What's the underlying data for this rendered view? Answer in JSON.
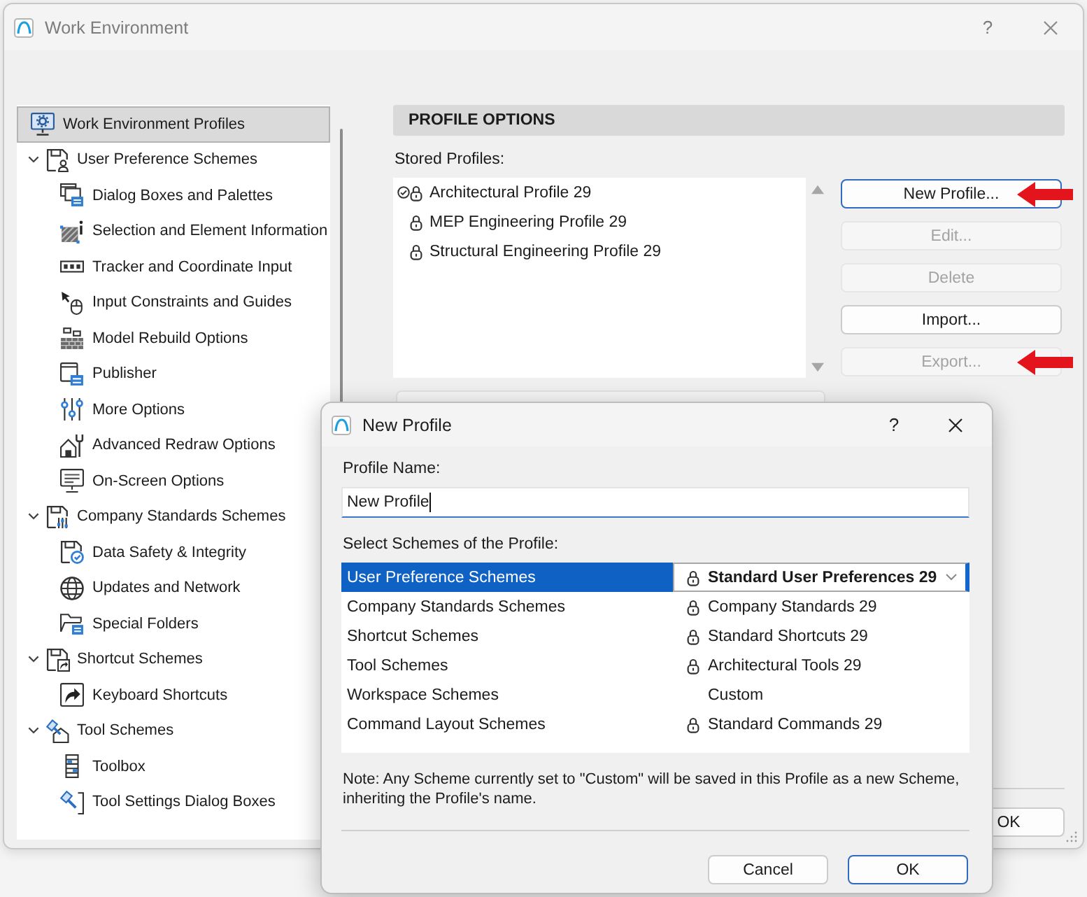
{
  "window": {
    "title": "Work Environment",
    "help": "?"
  },
  "sidebar": {
    "items": [
      {
        "label": "Work Environment Profiles",
        "selected": true
      },
      {
        "label": "User Preference Schemes",
        "selected": false,
        "expanded": true,
        "children": [
          {
            "label": "Dialog Boxes and Palettes",
            "selected": false
          },
          {
            "label": "Selection and Element Information",
            "selected": false
          },
          {
            "label": "Tracker and Coordinate Input",
            "selected": false
          },
          {
            "label": "Input Constraints and Guides",
            "selected": false
          },
          {
            "label": "Model Rebuild Options",
            "selected": false
          },
          {
            "label": "Publisher",
            "selected": false
          },
          {
            "label": "More Options",
            "selected": false
          },
          {
            "label": "Advanced Redraw Options",
            "selected": false
          },
          {
            "label": "On-Screen Options",
            "selected": false
          }
        ]
      },
      {
        "label": "Company Standards Schemes",
        "selected": false,
        "expanded": true,
        "children": [
          {
            "label": "Data Safety & Integrity",
            "selected": false
          },
          {
            "label": "Updates and Network",
            "selected": false
          },
          {
            "label": "Special Folders",
            "selected": false
          }
        ]
      },
      {
        "label": "Shortcut Schemes",
        "selected": false,
        "expanded": true,
        "children": [
          {
            "label": "Keyboard Shortcuts",
            "selected": false
          }
        ]
      },
      {
        "label": "Tool Schemes",
        "selected": false,
        "expanded": true,
        "children": [
          {
            "label": "Toolbox",
            "selected": false
          },
          {
            "label": "Tool Settings Dialog Boxes",
            "selected": false
          }
        ]
      }
    ]
  },
  "profile_options": {
    "heading": "PROFILE OPTIONS",
    "stored_label": "Stored Profiles:",
    "profiles": [
      {
        "name": "Architectural Profile 29",
        "current": true,
        "locked": true
      },
      {
        "name": "MEP Engineering Profile 29",
        "current": false,
        "locked": true
      },
      {
        "name": "Structural Engineering Profile 29",
        "current": false,
        "locked": true
      }
    ],
    "buttons": [
      {
        "label": "New Profile...",
        "disabled": false,
        "focused": true,
        "annotated": true
      },
      {
        "label": "Edit...",
        "disabled": true,
        "focused": false,
        "annotated": false
      },
      {
        "label": "Delete",
        "disabled": true,
        "focused": false,
        "annotated": false
      },
      {
        "label": "Import...",
        "disabled": false,
        "focused": false,
        "annotated": false
      },
      {
        "label": "Export...",
        "disabled": true,
        "focused": false,
        "annotated": true
      }
    ]
  },
  "footer": {
    "ok_button": "OK"
  },
  "dialog": {
    "title": "New Profile",
    "help": "?",
    "name_label": "Profile Name:",
    "name_value": "New Profile",
    "schemes_label": "Select Schemes of the Profile:",
    "schemes": [
      {
        "scheme": "User Preference Schemes",
        "selected": true,
        "value": "Standard User Preferences 29",
        "locked": true
      },
      {
        "scheme": "Company Standards Schemes",
        "selected": false,
        "value": "Company Standards 29",
        "locked": true
      },
      {
        "scheme": "Shortcut Schemes",
        "selected": false,
        "value": "Standard Shortcuts 29",
        "locked": true
      },
      {
        "scheme": "Tool Schemes",
        "selected": false,
        "value": "Architectural Tools 29",
        "locked": true
      },
      {
        "scheme": "Workspace Schemes",
        "selected": false,
        "value": "Custom",
        "locked": false
      },
      {
        "scheme": "Command Layout Schemes",
        "selected": false,
        "value": "Standard Commands 29",
        "locked": true
      }
    ],
    "note": "Note: Any Scheme currently set to \"Custom\" will be saved in this Profile as a new Scheme, inheriting the Profile's name.",
    "buttons": [
      {
        "label": "Cancel",
        "default": false
      },
      {
        "label": "OK",
        "default": true
      }
    ]
  }
}
